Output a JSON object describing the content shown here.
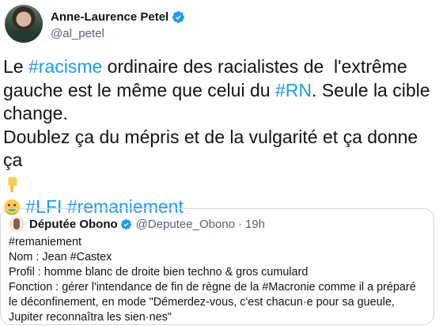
{
  "author": {
    "display_name": "Anne-Laurence Petel",
    "handle": "@al_petel"
  },
  "tweet": {
    "line1_pre": "Le ",
    "line1_tag": "#racisme",
    "line1_post": " ordinaire des racialistes de  l'extrême",
    "line2_pre": "gauche est le même que celui du ",
    "line2_tag": "#RN",
    "line2_post": ". Seule la cible",
    "line3": "change.",
    "line4": "Doublez ça du mépris et de la vulgarité et ça donne ça",
    "tag_lfi": "#LFI",
    "tag_remaniement": "#remaniement",
    "emojis": [
      "pointing-down-emoji",
      "nauseated-face-emoji"
    ]
  },
  "quoted_tweet": {
    "display_name": "Députée Obono",
    "handle": "@Deputee_Obono",
    "separator": "·",
    "time": "19h",
    "lines": [
      "#remaniement",
      "Nom : Jean #Castex",
      "Profil : homme blanc de droite bien techno & gros cumulard",
      "Fonction : gérer l'intendance de fin de règne de la #Macronie comme il a préparé",
      "le déconfinement, en mode \"Démerdez-vous, c'est chacun·e pour sa gueule,",
      "Jupiter reconnaîtra les sien·nes\""
    ]
  },
  "colors": {
    "link": "#1d9bf0",
    "verified": "#1d9bf0",
    "secondary_text": "#536471",
    "border": "#cfd9de"
  }
}
